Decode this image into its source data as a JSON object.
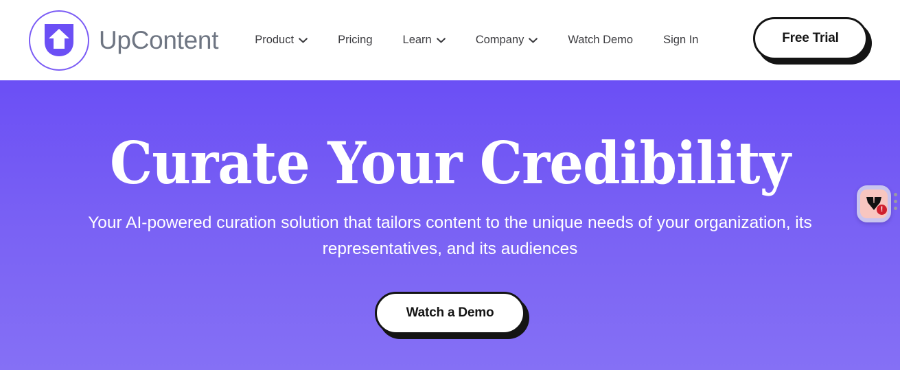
{
  "header": {
    "brand": {
      "name": "UpContent",
      "logo_icon": "upcontent-shield-arrow-logo",
      "accent_color": "#7b5cf5"
    },
    "nav": [
      {
        "label": "Product",
        "has_dropdown": true
      },
      {
        "label": "Pricing",
        "has_dropdown": false
      },
      {
        "label": "Learn",
        "has_dropdown": true
      },
      {
        "label": "Company",
        "has_dropdown": true
      },
      {
        "label": "Watch Demo",
        "has_dropdown": false
      },
      {
        "label": "Sign In",
        "has_dropdown": false
      }
    ],
    "cta": {
      "label": "Free Trial"
    }
  },
  "hero": {
    "title": "Curate Your Credibility",
    "subtitle": "Your AI-powered curation solution that tailors content to the unique needs of your organization, its representatives, and its audiences",
    "cta": {
      "label": "Watch a Demo"
    },
    "background_gradient_start": "#6b4ff5",
    "background_gradient_end": "#8570f5"
  },
  "floating_widget": {
    "icon": "messagebird-bird-icon",
    "badge": "!",
    "badge_color": "#cf1f2e",
    "frame_color": "#c9c4ef",
    "inner_color": "#f8c6c0",
    "drag_handle_icon": "three-dots-vertical-icon"
  }
}
